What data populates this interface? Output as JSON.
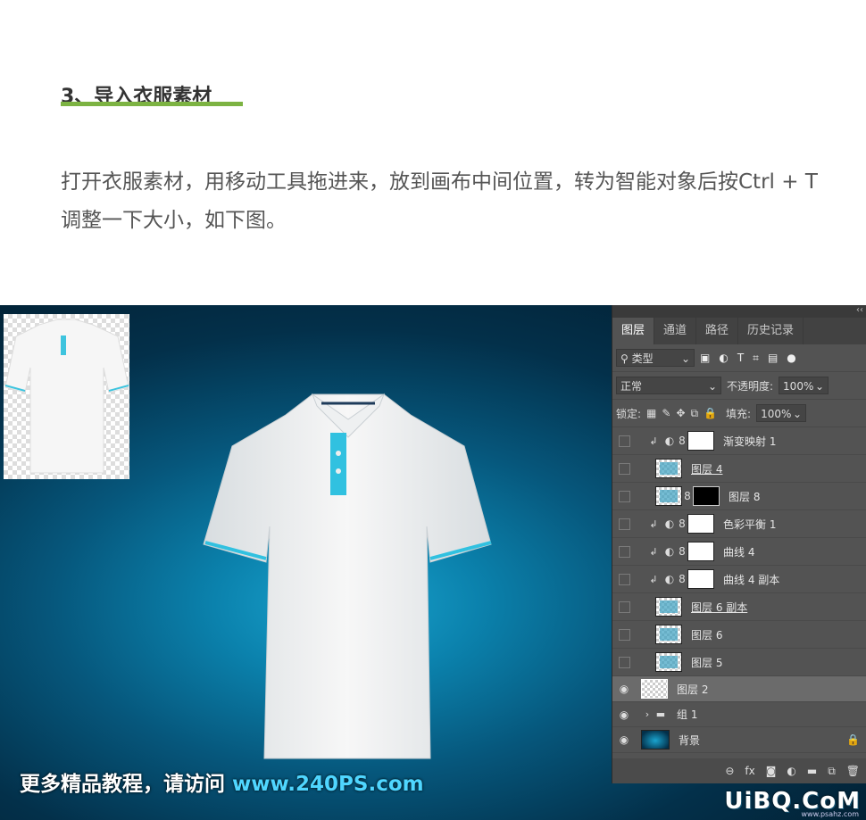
{
  "heading": "3、导入衣服素材",
  "paragraph": "打开衣服素材，用移动工具拖进来，放到画布中间位置，转为智能对象后按Ctrl + T 调整一下大小，如下图。",
  "watermark": {
    "prefix": "更多精品教程，请访问 ",
    "url": "www.240PS.com"
  },
  "logo": {
    "text": "UiBQ.CoM",
    "sub": "www.psahz.com"
  },
  "panel": {
    "tabs": [
      "图层",
      "通道",
      "路径",
      "历史记录"
    ],
    "filter_label": "类型",
    "blend_mode": "正常",
    "opacity_label": "不透明度:",
    "opacity_value": "100%",
    "lock_label": "锁定:",
    "fill_label": "填充:",
    "fill_value": "100%",
    "layers": [
      {
        "name": "渐变映射 1"
      },
      {
        "name": "图层 4"
      },
      {
        "name": "图层 8"
      },
      {
        "name": "色彩平衡 1"
      },
      {
        "name": "曲线 4"
      },
      {
        "name": "曲线 4 副本"
      },
      {
        "name": "图层 6 副本"
      },
      {
        "name": "图层 6"
      },
      {
        "name": "图层 5"
      },
      {
        "name": "图层 2"
      },
      {
        "name": "组 1"
      },
      {
        "name": "背景"
      }
    ],
    "bottom_icons": [
      "link-icon",
      "fx-icon",
      "mask-icon",
      "adjustment-icon",
      "folder-icon",
      "new-layer-icon",
      "trash-icon"
    ]
  }
}
